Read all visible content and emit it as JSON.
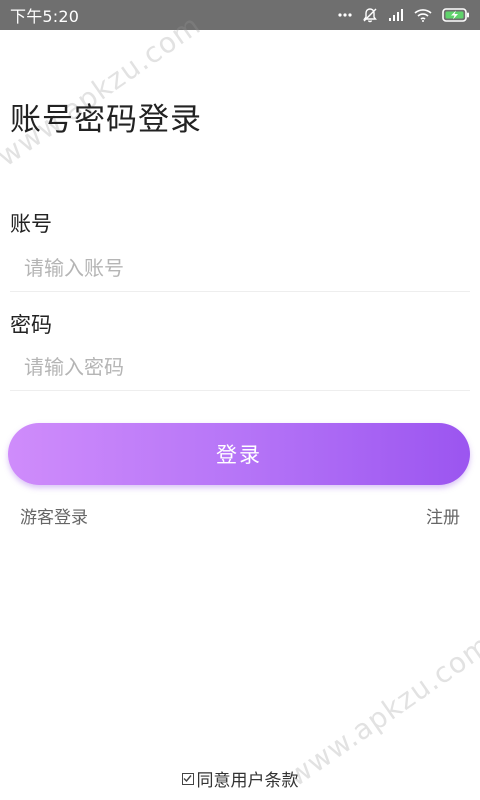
{
  "status_bar": {
    "time": "下午5:20",
    "icons": [
      "more-dots-icon",
      "mute-bell-icon",
      "signal-icon",
      "wifi-icon",
      "battery-charging-icon"
    ]
  },
  "watermark": {
    "text": "www.apkzu.com"
  },
  "login": {
    "title": "账号密码登录",
    "account_label": "账号",
    "account_placeholder": "请输入账号",
    "account_value": "",
    "password_label": "密码",
    "password_placeholder": "请输入密码",
    "password_value": "",
    "login_button_label": "登录",
    "guest_login_label": "游客登录",
    "register_label": "注册"
  },
  "agreement": {
    "label": "同意用户条款",
    "checked": true
  },
  "colors": {
    "status_bar_bg": "#6f6f6f",
    "button_gradient_start": "#cf8cfb",
    "button_gradient_end": "#9b55f0"
  }
}
